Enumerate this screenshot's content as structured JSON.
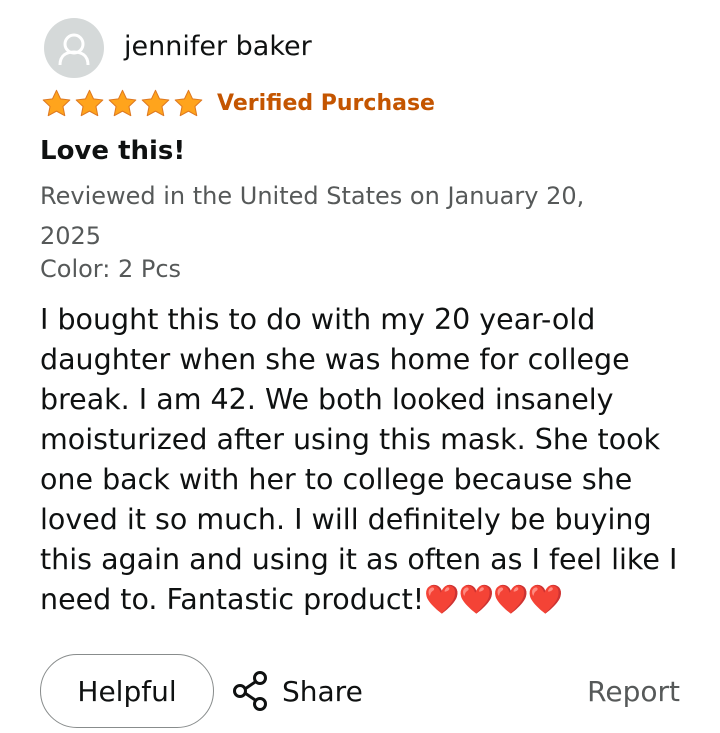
{
  "review": {
    "reviewer_name": "jennifer baker",
    "rating_stars": 5,
    "rating_max": 5,
    "verified_label": "Verified Purchase",
    "title": "Love this!",
    "meta": "Reviewed in the United States on January 20, 2025",
    "variant": "Color: 2 Pcs",
    "body": "I bought this to do with my 20 year-old daughter when she was home for college break. I am 42. We both looked insanely moisturized after using this mask. She took one back with her to college because she loved it so much. I will definitely be buying this again and using it as often as I feel like I need to. Fantastic product!",
    "body_emoji": "❤️❤️❤️❤️"
  },
  "actions": {
    "helpful_label": "Helpful",
    "share_label": "Share",
    "report_label": "Report"
  },
  "icons": {
    "avatar": "user-avatar-icon",
    "star": "star-icon",
    "share": "share-icon"
  },
  "colors": {
    "star": "#FFA41C",
    "star_outline": "#DE7921",
    "verified": "#C45500",
    "muted_text": "#565959",
    "body_text": "#0F1111",
    "heart": "#E5171F"
  }
}
